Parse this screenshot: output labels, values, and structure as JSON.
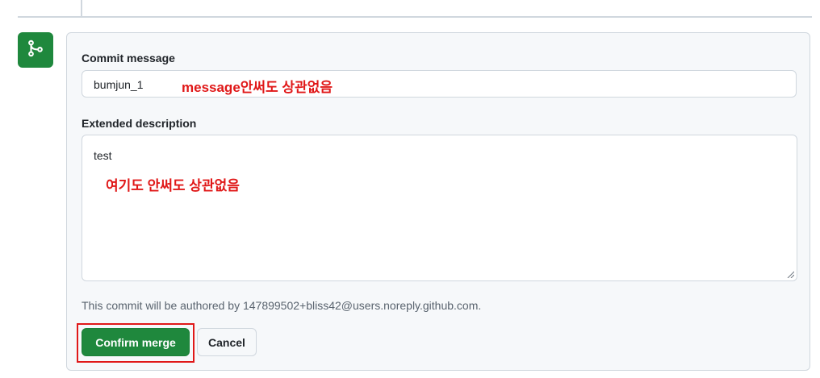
{
  "colors": {
    "merge_green": "#1f883d",
    "annotation_red": "#e01818",
    "border": "#d0d7de",
    "panel_bg": "#f6f8fa",
    "muted_text": "#59636e"
  },
  "merge_icon": "git-merge-icon",
  "commit_message": {
    "label": "Commit message",
    "value": "bumjun_1"
  },
  "extended_description": {
    "label": "Extended description",
    "value": "test"
  },
  "annotations": {
    "message_note": "message안써도 상관없음",
    "description_note": "여기도 안써도 상관없음"
  },
  "author_note": "This commit will be authored by 147899502+bliss42@users.noreply.github.com.",
  "buttons": {
    "confirm": "Confirm merge",
    "cancel": "Cancel"
  }
}
